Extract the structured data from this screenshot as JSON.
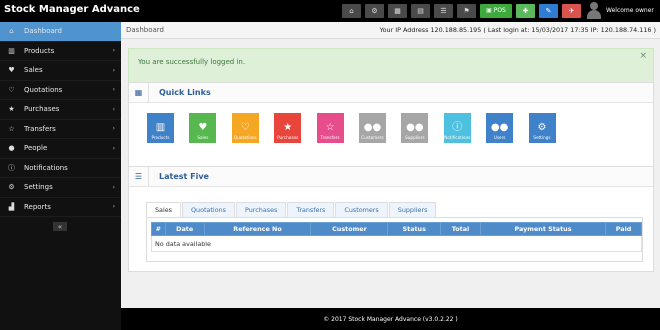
{
  "app": {
    "title": "Stock Manager Advance"
  },
  "topbar": {
    "buttons": [
      {
        "icon": "dashboard-icon",
        "glyph": "⌂"
      },
      {
        "icon": "settings-icon",
        "glyph": "⚙"
      },
      {
        "icon": "calculator-icon",
        "glyph": "▦"
      },
      {
        "icon": "calendar-icon",
        "glyph": "▤"
      },
      {
        "icon": "list-icon",
        "glyph": "☰"
      },
      {
        "icon": "flag-icon",
        "glyph": "⚑"
      }
    ],
    "pos_label": "POS",
    "pos_glyph": "▣",
    "gift_glyph": "✚",
    "notes_glyph": "✎",
    "clear_glyph": "✈",
    "welcome": "Welcome owner"
  },
  "sidebar": {
    "items": [
      {
        "label": "Dashboard",
        "icon": "dashboard-icon",
        "glyph": "⌂",
        "active": true,
        "chev": ""
      },
      {
        "label": "Products",
        "icon": "barcode-icon",
        "glyph": "▥",
        "chev": "›"
      },
      {
        "label": "Sales",
        "icon": "heart-icon",
        "glyph": "♥",
        "chev": "›"
      },
      {
        "label": "Quotations",
        "icon": "heart-outline-icon",
        "glyph": "♡",
        "chev": "›"
      },
      {
        "label": "Purchases",
        "icon": "star-icon",
        "glyph": "★",
        "chev": "›"
      },
      {
        "label": "Transfers",
        "icon": "star-outline-icon",
        "glyph": "☆",
        "chev": "›"
      },
      {
        "label": "People",
        "icon": "users-icon",
        "glyph": "●",
        "chev": "›"
      },
      {
        "label": "Notifications",
        "icon": "info-icon",
        "glyph": "ⓘ",
        "chev": ""
      },
      {
        "label": "Settings",
        "icon": "cog-icon",
        "glyph": "⚙",
        "chev": "›"
      },
      {
        "label": "Reports",
        "icon": "bar-chart-icon",
        "glyph": "▟",
        "chev": "›"
      }
    ],
    "collapse_glyph": "«"
  },
  "breadcrumb": "Dashboard",
  "ip_info": "Your IP Address 120.188.85.195 ( Last login at: 15/03/2017 17:35 IP: 120.188.74.116 )",
  "alert": {
    "text": "You are successfully logged in.",
    "close": "×"
  },
  "quick_links": {
    "title": "Quick Links",
    "items": [
      {
        "label": "Products",
        "glyph": "▥",
        "color": "#3f82c9"
      },
      {
        "label": "Sales",
        "glyph": "♥",
        "color": "#56b84e"
      },
      {
        "label": "Quotations",
        "glyph": "♡",
        "color": "#f5a623"
      },
      {
        "label": "Purchases",
        "glyph": "★",
        "color": "#e8453c"
      },
      {
        "label": "Transfers",
        "glyph": "☆",
        "color": "#e64d8a"
      },
      {
        "label": "Customers",
        "glyph": "●●",
        "color": "#a6a6a6"
      },
      {
        "label": "Suppliers",
        "glyph": "●●",
        "color": "#a6a6a6"
      },
      {
        "label": "Notifications",
        "glyph": "ⓘ",
        "color": "#4ec0e0"
      },
      {
        "label": "Users",
        "glyph": "●●",
        "color": "#3f82c9"
      },
      {
        "label": "Settings",
        "glyph": "⚙",
        "color": "#3f82c9"
      }
    ]
  },
  "latest_five": {
    "title": "Latest Five",
    "tabs": [
      "Sales",
      "Quotations",
      "Purchases",
      "Transfers",
      "Customers",
      "Suppliers"
    ],
    "columns": [
      "#",
      "Date",
      "Reference No",
      "Customer",
      "Status",
      "Total",
      "Payment Status",
      "Paid"
    ],
    "empty_text": "No data available"
  },
  "footer": "© 2017 Stock Manager Advance (v3.0.2.22 )"
}
